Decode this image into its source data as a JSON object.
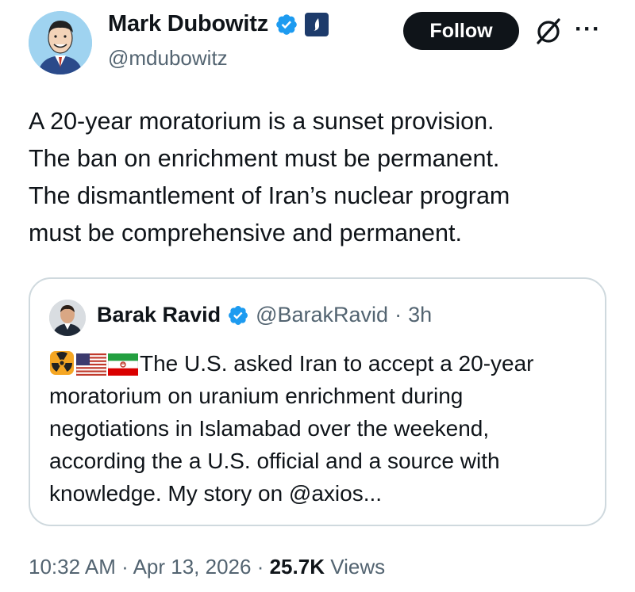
{
  "author": {
    "display_name": "Mark Dubowitz",
    "handle": "@mdubowitz"
  },
  "actions": {
    "follow_label": "Follow"
  },
  "tweet": {
    "text": "A 20-year moratorium is a sunset provision.\nThe ban on enrichment must be permanent.\nThe dismantlement of Iran’s nuclear program\nmust be comprehensive and permanent."
  },
  "quote": {
    "display_name": "Barak Ravid",
    "handle": "@BarakRavid",
    "separator": "·",
    "time": "3h",
    "text": "The U.S. asked Iran to accept a 20-year moratorium on uranium enrichment during negotiations in Islamabad over the weekend, according the a U.S. official and a source with knowledge. My story on @axios..."
  },
  "meta": {
    "time": "10:32 AM",
    "sep1": "·",
    "date": "Apr 13, 2026",
    "sep2": "·",
    "views_count": "25.7K",
    "views_label": "Views"
  },
  "icons": {
    "verified": "verified-badge-icon",
    "affiliation": "affiliation-badge-icon",
    "grok": "grok-icon",
    "more": "more-icon",
    "radioactive": "radioactive-emoji",
    "us_flag": "us-flag-emoji",
    "iran_flag": "iran-flag-emoji"
  },
  "colors": {
    "verified_blue": "#1d9bf0",
    "follow_bg": "#0f1419",
    "secondary_text": "#536471",
    "border": "#cfd9de"
  }
}
